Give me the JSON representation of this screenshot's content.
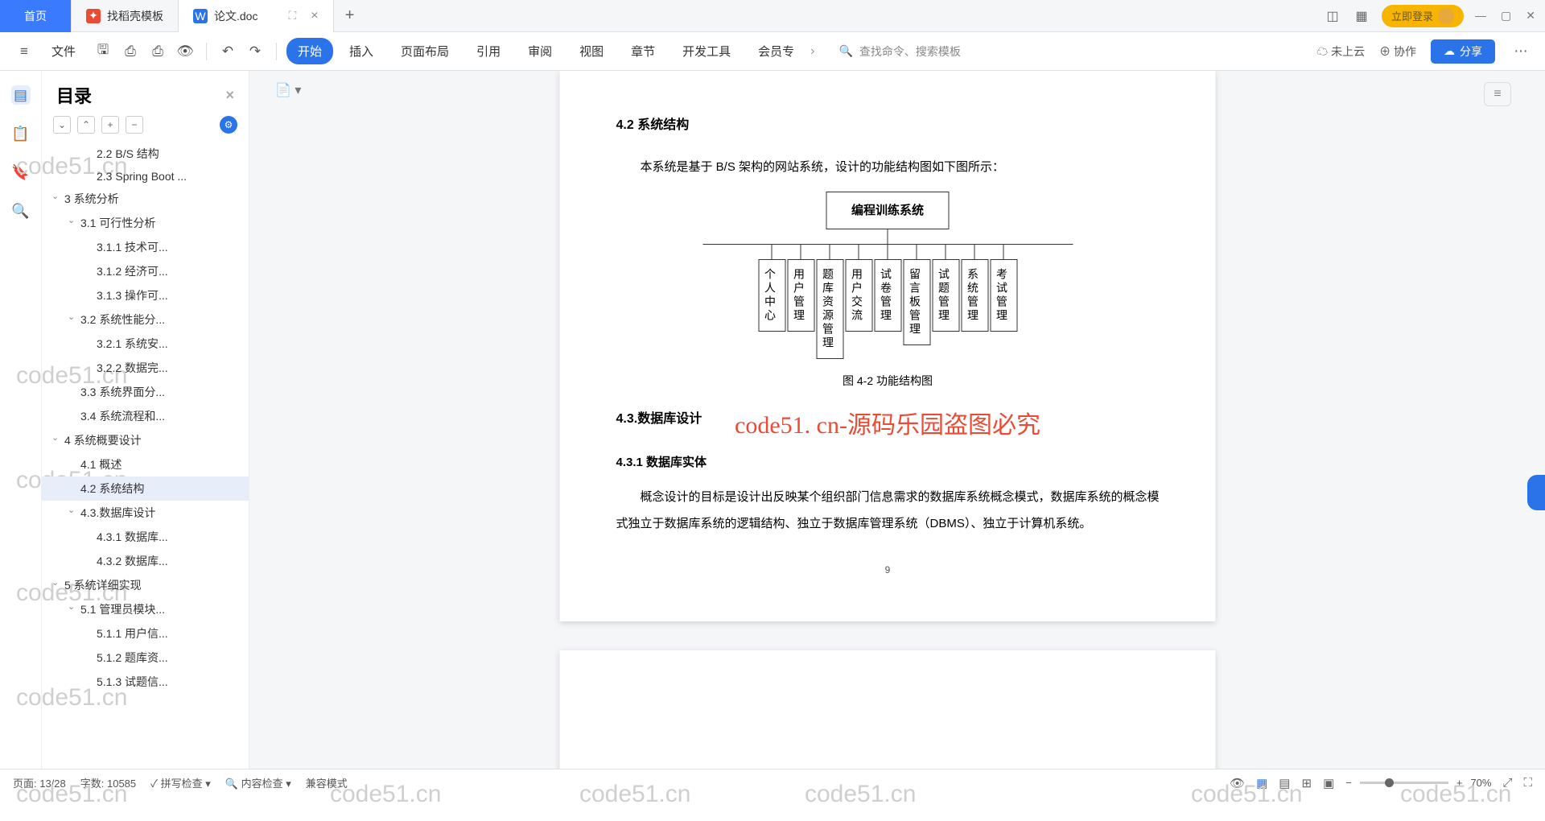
{
  "tabs": {
    "home": "首页",
    "template": "找稻壳模板",
    "doc": "论文.doc",
    "new": "+"
  },
  "title_right": {
    "login": "立即登录"
  },
  "ribbon": {
    "file": "文件",
    "menu": [
      "开始",
      "插入",
      "页面布局",
      "引用",
      "审阅",
      "视图",
      "章节",
      "开发工具",
      "会员专"
    ],
    "search": "查找命令、搜索模板",
    "cloud": "未上云",
    "collab": "协作",
    "share": "分享"
  },
  "outline": {
    "title": "目录",
    "items": [
      {
        "t": "2.2 B/S 结构",
        "lv": 3
      },
      {
        "t": "2.3 Spring Boot ...",
        "lv": 3
      },
      {
        "t": "3 系统分析",
        "lv": 1,
        "c": 1
      },
      {
        "t": "3.1 可行性分析",
        "lv": 2,
        "c": 1
      },
      {
        "t": "3.1.1 技术可...",
        "lv": 3
      },
      {
        "t": "3.1.2 经济可...",
        "lv": 3
      },
      {
        "t": "3.1.3 操作可...",
        "lv": 3
      },
      {
        "t": "3.2 系统性能分...",
        "lv": 2,
        "c": 1
      },
      {
        "t": "3.2.1 系统安...",
        "lv": 3
      },
      {
        "t": "3.2.2 数据完...",
        "lv": 3
      },
      {
        "t": "3.3 系统界面分...",
        "lv": 2
      },
      {
        "t": "3.4 系统流程和...",
        "lv": 2
      },
      {
        "t": "4 系统概要设计",
        "lv": 1,
        "c": 1
      },
      {
        "t": "4.1 概述",
        "lv": 2
      },
      {
        "t": "4.2 系统结构",
        "lv": 2,
        "a": 1
      },
      {
        "t": "4.3.数据库设计",
        "lv": 2,
        "c": 1
      },
      {
        "t": "4.3.1 数据库...",
        "lv": 3
      },
      {
        "t": "4.3.2 数据库...",
        "lv": 3
      },
      {
        "t": "5 系统详细实现",
        "lv": 1,
        "c": 1
      },
      {
        "t": "5.1 管理员模块...",
        "lv": 2,
        "c": 1
      },
      {
        "t": "5.1.1 用户信...",
        "lv": 3
      },
      {
        "t": "5.1.2 题库资...",
        "lv": 3
      },
      {
        "t": "5.1.3 试题信...",
        "lv": 3
      }
    ]
  },
  "doc": {
    "h42": "4.2 系统结构",
    "p1": "本系统是基于 B/S 架构的网站系统，设计的功能结构图如下图所示：",
    "fig_root": "编程训练系统",
    "fig_leaves": [
      "个人中心",
      "用户管理",
      "题库资源管理",
      "用户交流",
      "试卷管理",
      "留言板管理",
      "试题管理",
      "系统管理",
      "考试管理"
    ],
    "fig_caption": "图 4-2 功能结构图",
    "h43": "4.3.数据库设计",
    "h431": "4.3.1 数据库实体",
    "p2": "概念设计的目标是设计出反映某个组织部门信息需求的数据库系统概念模式，数据库系统的概念模式独立于数据库系统的逻辑结构、独立于数据库管理系统（DBMS）、独立于计算机系统。",
    "pagenum": "9"
  },
  "watermark": "code51. cn-源码乐园盗图必究",
  "bg_wm": "code51.cn",
  "status": {
    "page": "页面: 13/28",
    "words": "字数: 10585",
    "spell": "拼写检查",
    "content": "内容检查",
    "compat": "兼容模式",
    "zoom": "70%"
  }
}
